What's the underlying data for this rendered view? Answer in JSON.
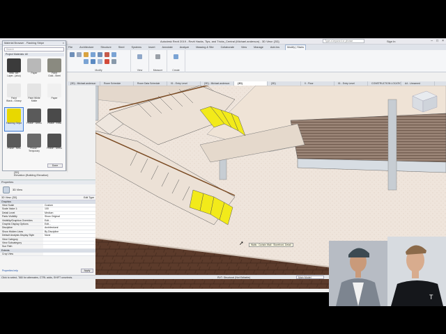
{
  "window": {
    "title": "Autodesk Revit 2019 - Revit Hacks, Tips, and Tricks_Central (Michael.anderson) - 3D View: {3D}",
    "search_placeholder": "Type a keyword or phrase",
    "signin": "Sign In"
  },
  "ribbon_tabs": [
    "File",
    "Architecture",
    "Structure",
    "Steel",
    "Systems",
    "Insert",
    "Annotate",
    "Analyze",
    "Massing & Site",
    "Collaborate",
    "View",
    "Manage",
    "Add-Ins",
    "Modify | Stairs"
  ],
  "ribbon_groups": [
    "Modify",
    "View",
    "Measure",
    "Create"
  ],
  "material_browser": {
    "title": "Material Browser - Flashing Stripe",
    "search_placeholder": "Search",
    "header": "Project Materials: All",
    "done_label": "Done",
    "materials": [
      {
        "label": "Misc. Alt. Layer...(also)",
        "color": "#3b3b3b"
      },
      {
        "label": "Paper",
        "color": "#b8b8b8"
      },
      {
        "label": "Paint Gold...Steel",
        "color": "#8a8a80"
      },
      {
        "label": "Paint Black...Glossy",
        "color": "#e8e8e8"
      },
      {
        "label": "Paint White Matte",
        "color": "#e4e4e4"
      },
      {
        "label": "Paper",
        "color": "#f0f0f0"
      },
      {
        "label": "Flashing Stripe",
        "color": "#e8d800"
      },
      {
        "label": "Phase - Demo",
        "color": "#5a5a5a"
      },
      {
        "label": "Phase - Exist",
        "color": "#4a4a4a"
      },
      {
        "label": "Phase - New",
        "color": "#5a5a5a"
      },
      {
        "label": "Phase - Temporary",
        "color": "#6a6a6a"
      },
      {
        "label": "Phase - Demo",
        "color": "#505050"
      }
    ]
  },
  "project_browser": {
    "item": "Elevation (Building Elevation)",
    "label": "{3D}"
  },
  "properties": {
    "title": "Properties",
    "type_name": "3D View",
    "filter_label": "3D View: {3D}",
    "edit_type": "Edit Type",
    "category": "Graphics",
    "rows": [
      {
        "k": "View Scale",
        "v": "Custom"
      },
      {
        "k": "Scale Value    1:",
        "v": "100"
      },
      {
        "k": "Detail Level",
        "v": "Medium"
      },
      {
        "k": "Parts Visibility",
        "v": "Show Original"
      },
      {
        "k": "Visibility/Graphics Overrides",
        "v": "Edit..."
      },
      {
        "k": "Graphic Display Options",
        "v": "Edit..."
      },
      {
        "k": "Discipline",
        "v": "Architectural"
      },
      {
        "k": "Show Hidden Lines",
        "v": "By Discipline"
      },
      {
        "k": "Default Analysis Display Style",
        "v": "None"
      },
      {
        "k": "View Category",
        "v": ""
      },
      {
        "k": "View Subcategory",
        "v": ""
      },
      {
        "k": "Sun Path",
        "v": ""
      }
    ],
    "category2": "Extents",
    "crop_label": "Crop View",
    "help": "Properties help",
    "apply": "Apply"
  },
  "view_tabs": [
    "{3D} - Michael.anderson",
    "Room Schedule",
    "Room Data Schedule",
    "01 - Entry Level",
    "{3D} - Michael.anderson",
    "{3D}",
    "{3D}",
    "0 - Floor",
    "01 - Entry Level",
    "CONSTRUCTION LOCATION",
    "A4 - Unnamed"
  ],
  "tooltip": "Walls : Curtain Wall : Storefront, Detail",
  "status": {
    "hint": "Click to select, TAB for alternates, CTRL adds, SHIFT unselects.",
    "workset": "RVT: Structural (Not Editable)",
    "main_model": "Main Model"
  },
  "colors": {
    "flash_yellow": "#f2ea1a",
    "floor": "#efe6de",
    "wood": "#5b3a2a"
  }
}
